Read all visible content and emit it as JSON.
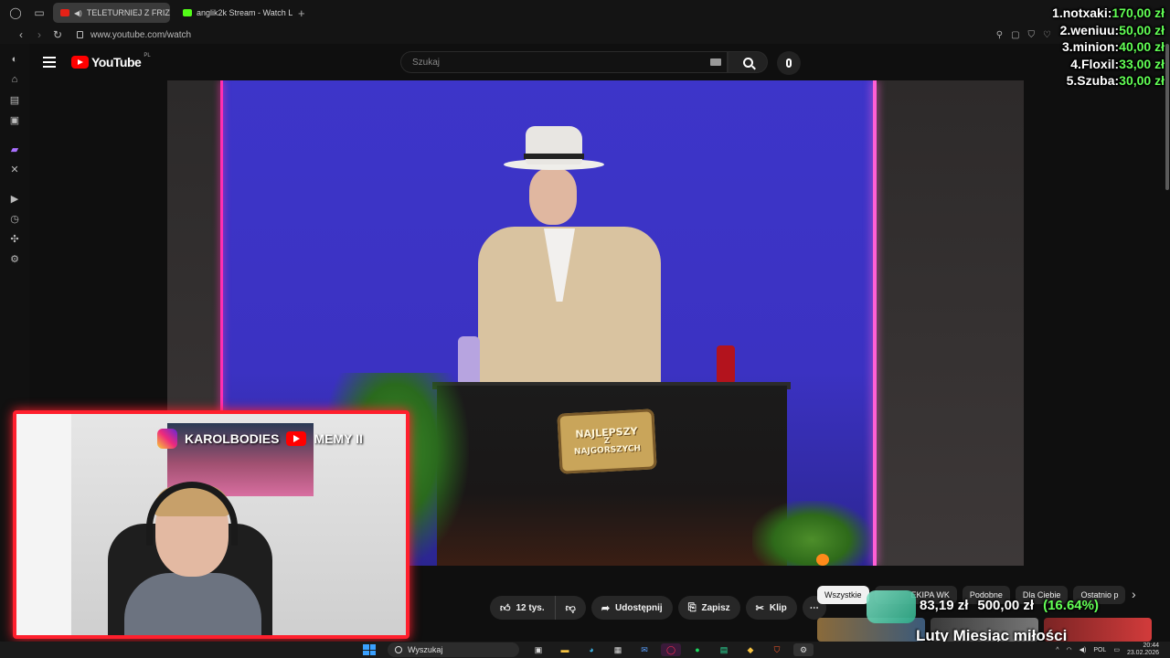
{
  "browser": {
    "tabs": [
      {
        "label": "TELETURNIEJ Z FRIZE",
        "active": true,
        "favicon": "youtube-icon"
      },
      {
        "label": "anglik2k Stream - Watch L",
        "active": false,
        "favicon": "kick-icon"
      }
    ],
    "new_tab": "+",
    "url": "www.youtube.com/watch"
  },
  "youtube": {
    "logo_text": "YouTube",
    "region": "PL",
    "search_placeholder": "Szukaj",
    "actions": {
      "like_count": "12 tys.",
      "share": "Udostępnij",
      "save": "Zapisz",
      "clip": "Klip",
      "more": "⋯"
    },
    "chips": [
      "Wszystkie",
      "EKIPA WK",
      "Podobne",
      "Dla Ciebie",
      "Ostatnio p"
    ]
  },
  "video": {
    "desk_logo_line1": "NAJLEPSZY",
    "desk_logo_line2": "Z",
    "desk_logo_line3": "NAJGORSZYCH"
  },
  "overlay": {
    "donors": [
      {
        "rank_name": "1.notxaki:",
        "amount": "170,00 zł"
      },
      {
        "rank_name": "2.weniuu:",
        "amount": "50,00 zł"
      },
      {
        "rank_name": "3.minion:",
        "amount": "40,00 zł"
      },
      {
        "rank_name": "4.Floxil:",
        "amount": "33,00 zł"
      },
      {
        "rank_name": "5.Szuba:",
        "amount": "30,00 zł"
      }
    ],
    "goal": {
      "current": "83,19 zł",
      "target": "500,00 zł",
      "percent": "(16.64%)",
      "title": "Luty Miesiąc miłości",
      "progress": 0.1664
    },
    "cam_social_left": "KAROLBODIES",
    "cam_social_right": "MEMY II"
  },
  "taskbar": {
    "search_label": "Wyszukaj",
    "language": "POL",
    "time": "20:44",
    "date": "23.02.2026"
  },
  "colors": {
    "accent_red": "#ff1f2d",
    "donation_green": "#62ff55",
    "youtube_red": "#ff0000"
  }
}
